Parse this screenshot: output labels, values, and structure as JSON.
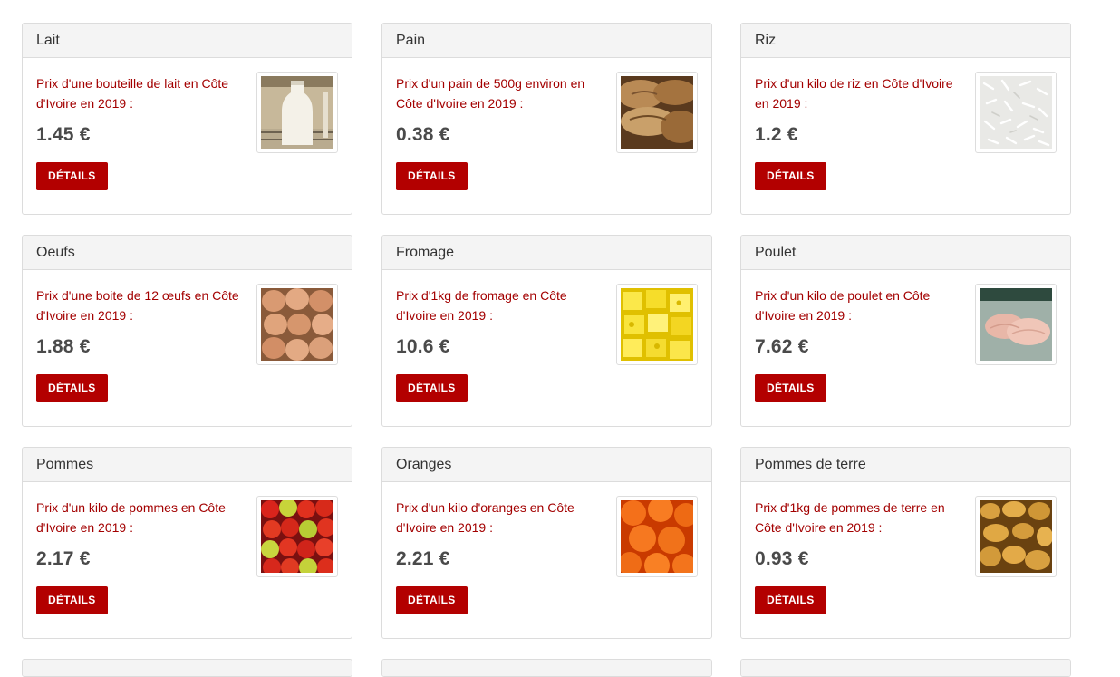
{
  "products": [
    {
      "name": "Lait",
      "description": "Prix d'une bouteille de lait en Côte d'Ivoire en 2019 :",
      "price": "1.45 €",
      "button": "DÉTAILS",
      "image": "milk-bottle-image"
    },
    {
      "name": "Pain",
      "description": "Prix d'un pain de 500g environ en Côte d'Ivoire en 2019 :",
      "price": "0.38 €",
      "button": "DÉTAILS",
      "image": "bread-image"
    },
    {
      "name": "Riz",
      "description": "Prix d'un kilo de riz en Côte d'Ivoire en 2019 :",
      "price": "1.2 €",
      "button": "DÉTAILS",
      "image": "rice-image"
    },
    {
      "name": "Oeufs",
      "description": "Prix d'une boite de 12 œufs en Côte d'Ivoire en 2019 :",
      "price": "1.88 €",
      "button": "DÉTAILS",
      "image": "eggs-image"
    },
    {
      "name": "Fromage",
      "description": "Prix d'1kg de fromage en Côte d'Ivoire en 2019 :",
      "price": "10.6 €",
      "button": "DÉTAILS",
      "image": "cheese-image"
    },
    {
      "name": "Poulet",
      "description": "Prix d'un kilo de poulet en Côte d'Ivoire en 2019 :",
      "price": "7.62 €",
      "button": "DÉTAILS",
      "image": "chicken-image"
    },
    {
      "name": "Pommes",
      "description": "Prix d'un kilo de pommes en Côte d'Ivoire en 2019 :",
      "price": "2.17 €",
      "button": "DÉTAILS",
      "image": "apples-image"
    },
    {
      "name": "Oranges",
      "description": "Prix d'un kilo d'oranges en Côte d'Ivoire en 2019 :",
      "price": "2.21 €",
      "button": "DÉTAILS",
      "image": "oranges-image"
    },
    {
      "name": "Pommes de terre",
      "description": "Prix d'1kg de pommes de terre en Côte d'Ivoire en 2019 :",
      "price": "0.93 €",
      "button": "DÉTAILS",
      "image": "potatoes-image"
    }
  ],
  "colors": {
    "accent": "#b30000",
    "description_text": "#a30000",
    "header_bg": "#f4f4f4",
    "border": "#dcdcdc"
  }
}
